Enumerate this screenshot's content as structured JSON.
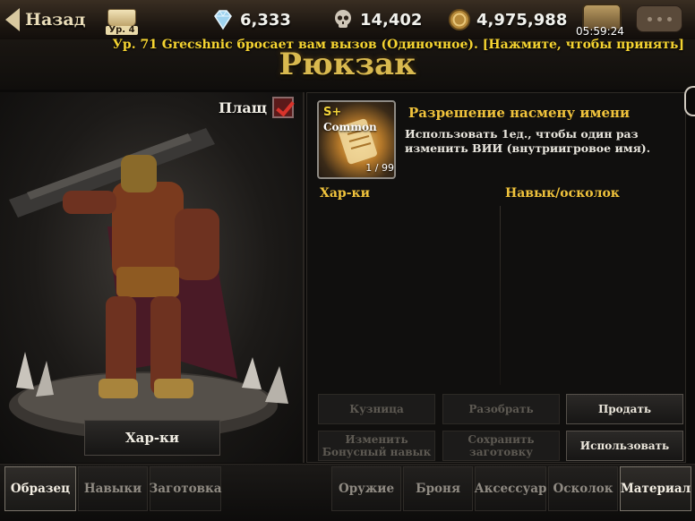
{
  "topbar": {
    "back_label": "Назад",
    "level_badge": "Ур. 4",
    "gems": "6,333",
    "skulls": "14,402",
    "gold": "4,975,988",
    "chest_timer": "05:59:24",
    "icons": {
      "back": "back-arrow-icon",
      "level": "open-book-icon",
      "gems": "diamond-icon",
      "skulls": "skull-icon",
      "gold": "gold-coin-icon",
      "chest": "treasure-chest-icon",
      "chat": "chat-bubble-icon"
    }
  },
  "challenge_banner": "Ур. 71 Grecshnic бросает вам вызов (Одиночное). [Нажмите, чтобы принять]",
  "page_title": "Рюкзак",
  "character": {
    "cloak_label": "Плащ",
    "cloak_checked": true,
    "stats_button": "Хар-ки"
  },
  "item": {
    "grade": "S+",
    "rarity": "Common",
    "count": "1 / 99",
    "name": "Разрешение насмену имени ",
    "description": "Использовать 1ед., чтобы один раз изменить ВИИ (внутриигровое имя).",
    "icon": "scroll-icon"
  },
  "columns": {
    "stats": "Хар-ки",
    "skill": "Навык/осколок"
  },
  "actions": {
    "forge": "Кузница",
    "dismantle": "Разобрать",
    "sell": "Продать",
    "change_skill": "Изменить Бонусный навык",
    "save_preset": "Сохранить заготовку",
    "use": "Использовать"
  },
  "tabs": {
    "sample": "Образец",
    "skills": "Навыки",
    "presets": "Заготовка",
    "weapon": "Оружие",
    "armor": "Броня",
    "accessory": "Аксессуар",
    "shard": "Осколок",
    "material": "Материал"
  },
  "colors": {
    "accent_gold": "#f0c33c",
    "banner_yellow": "#f5d431",
    "checkbox_red": "#d9332b"
  }
}
